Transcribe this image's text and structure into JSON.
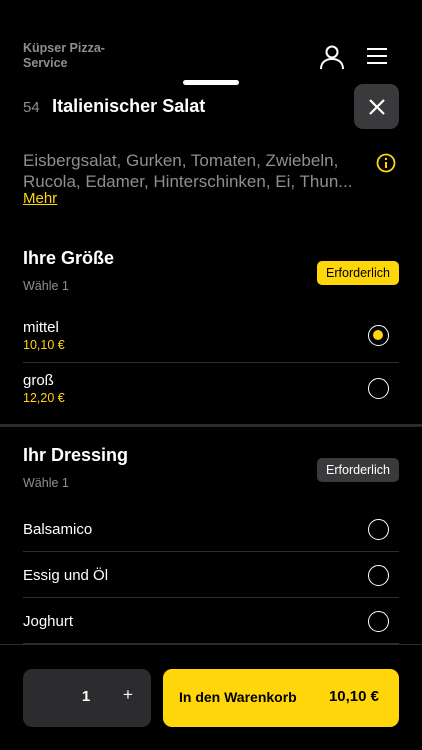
{
  "header": {
    "brand": "Küpser Pizza-Service",
    "icons": {
      "user": "user-icon",
      "menu": "hamburger-menu-icon"
    }
  },
  "item": {
    "number": "54",
    "title": "Italienischer Salat",
    "description": "Eisbergsalat, Gurken, Tomaten, Zwiebeln, Rucola, Edamer, Hinterschinken, Ei, Thun...",
    "more_link": "Mehr",
    "icons": {
      "close": "close-icon",
      "info": "info-icon"
    }
  },
  "groups": [
    {
      "title": "Ihre Größe",
      "subtitle": "Wähle 1",
      "badge": "Erforderlich",
      "options": [
        {
          "name": "mittel",
          "price": "10,10 €",
          "selected": true
        },
        {
          "name": "groß",
          "price": "12,20 €",
          "selected": false
        }
      ]
    },
    {
      "title": "Ihr Dressing",
      "subtitle": "Wähle 1",
      "badge": "Erforderlich",
      "options": [
        {
          "name": "Balsamico",
          "selected": false
        },
        {
          "name": "Essig und Öl",
          "selected": false
        },
        {
          "name": "Joghurt",
          "selected": false
        }
      ]
    }
  ],
  "footer": {
    "quantity": "1",
    "plus": "+",
    "cart_label": "In den Warenkorb",
    "cart_price": "10,10 €"
  },
  "colors": {
    "accent": "#ffd60a",
    "background": "#000000",
    "muted": "#8e8e93",
    "surface": "#2c2c2e"
  }
}
